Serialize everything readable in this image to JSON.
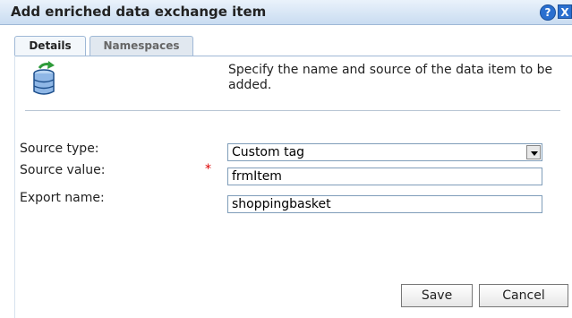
{
  "dialog": {
    "title": "Add enriched data exchange item",
    "help": "?",
    "close": "X"
  },
  "tabs": [
    {
      "label": "Details",
      "active": true
    },
    {
      "label": "Namespaces",
      "active": false
    }
  ],
  "intro": "Specify the name and source of the data item to be added.",
  "icon": "database-add-icon",
  "form": {
    "source_type_label": "Source type:",
    "source_type_value": "Custom tag",
    "source_value_label": "Source value:",
    "source_value_required": "*",
    "source_value_value": "frmItem",
    "export_name_label": "Export name:",
    "export_name_value": "shoppingbasket"
  },
  "buttons": {
    "save": "Save",
    "cancel": "Cancel"
  }
}
